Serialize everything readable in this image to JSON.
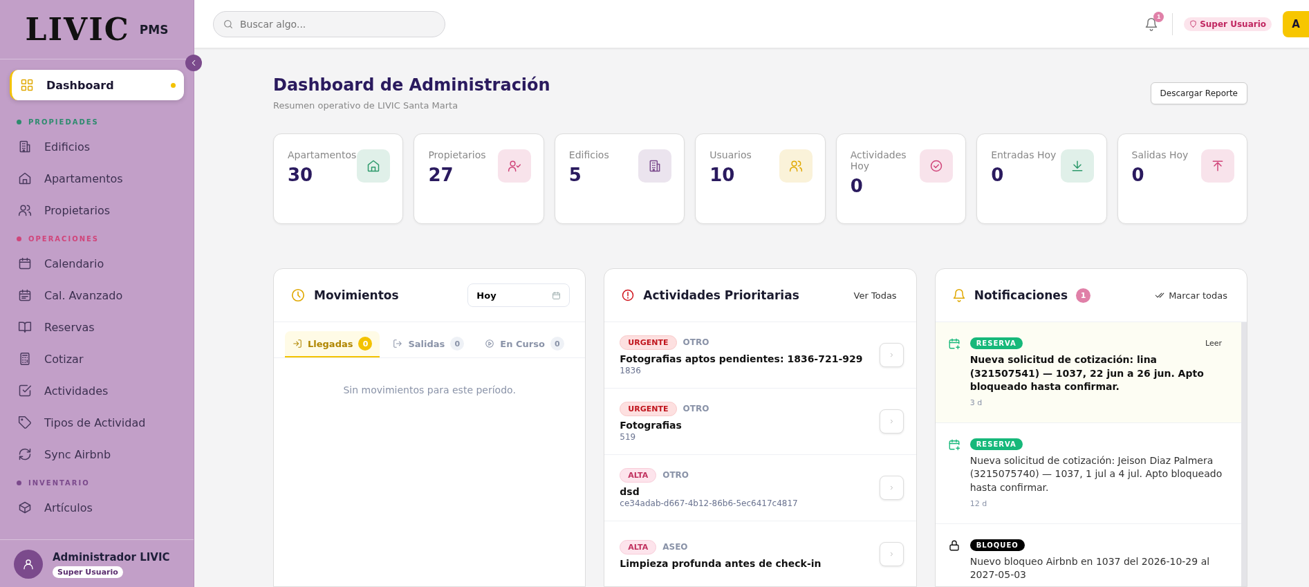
{
  "sidebar": {
    "logo": {
      "text": "LIVIC",
      "suffix": "PMS"
    },
    "items": [
      {
        "label": "Dashboard",
        "selected": true
      }
    ],
    "sections": [
      {
        "title": "PROPIEDADES",
        "color": "#2e8b6e",
        "items": [
          {
            "label": "Edificios",
            "selected": false
          },
          {
            "label": "Apartamentos",
            "selected": false
          },
          {
            "label": "Propietarios",
            "selected": false
          }
        ]
      },
      {
        "title": "OPERACIONES",
        "color": "#d0457a",
        "items": [
          {
            "label": "Calendario",
            "selected": false
          },
          {
            "label": "Cal. Avanzado",
            "selected": false
          },
          {
            "label": "Reservas",
            "selected": false
          },
          {
            "label": "Cotizar",
            "selected": false
          },
          {
            "label": "Actividades",
            "selected": false
          },
          {
            "label": "Tipos de Actividad",
            "selected": false
          },
          {
            "label": "Sync Airbnb",
            "selected": false
          }
        ]
      },
      {
        "title": "INVENTARIO",
        "color": "#7b4a8c",
        "items": [
          {
            "label": "Artículos",
            "selected": false
          }
        ]
      }
    ],
    "user": {
      "name": "Administrador LIVIC",
      "role": "Super Usuario"
    }
  },
  "header": {
    "search": {
      "placeholder": "Buscar algo..."
    },
    "notification_count": "1",
    "role": "Super Usuario",
    "avatar": "A"
  },
  "page": {
    "title": "Dashboard de Administración",
    "subtitle": "Resumen operativo de LIVIC Santa Marta",
    "download_button": "Descargar Reporte"
  },
  "stats": [
    {
      "label": "Apartamentos",
      "value": "30",
      "color": "#2e9a6c"
    },
    {
      "label": "Propietarios",
      "value": "27",
      "color": "#d0457a"
    },
    {
      "label": "Edificios",
      "value": "5",
      "color": "#7b4a8c"
    },
    {
      "label": "Usuarios",
      "value": "10",
      "color": "#e0a800"
    },
    {
      "label": "Actividades Hoy",
      "value": "0",
      "color": "#d0457a"
    },
    {
      "label": "Entradas Hoy",
      "value": "0",
      "color": "#2e9a6c"
    },
    {
      "label": "Salidas Hoy",
      "value": "0",
      "color": "#d0457a"
    }
  ],
  "movements": {
    "title": "Movimientos",
    "filter": "Hoy",
    "tabs": [
      {
        "label": "Llegadas",
        "count": "0",
        "selected": true
      },
      {
        "label": "Salidas",
        "count": "0",
        "selected": false
      },
      {
        "label": "En Curso",
        "count": "0",
        "selected": false
      }
    ],
    "empty": "Sin movimientos para este período."
  },
  "activities": {
    "title": "Actividades Prioritarias",
    "link": "Ver Todas",
    "items": [
      {
        "priority": "URGENTE",
        "kind": "urgente",
        "category": "OTRO",
        "title": "Fotografias aptos pendientes: 1836-721-929",
        "subtitle": "1836"
      },
      {
        "priority": "URGENTE",
        "kind": "urgente",
        "category": "OTRO",
        "title": "Fotografias",
        "subtitle": "519"
      },
      {
        "priority": "ALTA",
        "kind": "alta",
        "category": "OTRO",
        "title": "dsd",
        "subtitle": "ce34adab-d667-4b12-86b6-5ec6417c4817"
      },
      {
        "priority": "ALTA",
        "kind": "alta",
        "category": "ASEO",
        "title": "Limpieza profunda antes de check-in"
      }
    ]
  },
  "notifications": {
    "title": "Notificaciones",
    "count": "1",
    "mark_all": "Marcar todas",
    "items": [
      {
        "kind": "reserva",
        "tag": "RESERVA",
        "text": "Nueva solicitud de cotización: lina (321507541) — 1037, 22 jun a 26 jun. Apto bloqueado hasta confirmar.",
        "time": "3 d",
        "unread": true,
        "action": "Leer"
      },
      {
        "kind": "reserva",
        "tag": "RESERVA",
        "text": "Nueva solicitud de cotización: Jeison Diaz Palmera (3215075740) — 1037, 1 jul a 4 jul. Apto bloqueado hasta confirmar.",
        "time": "12 d",
        "unread": false
      },
      {
        "kind": "bloqueo",
        "tag": "BLOQUEO",
        "text": "Nuevo bloqueo Airbnb en 1037 del 2026-10-29 al 2027-05-03",
        "unread": false
      }
    ]
  }
}
